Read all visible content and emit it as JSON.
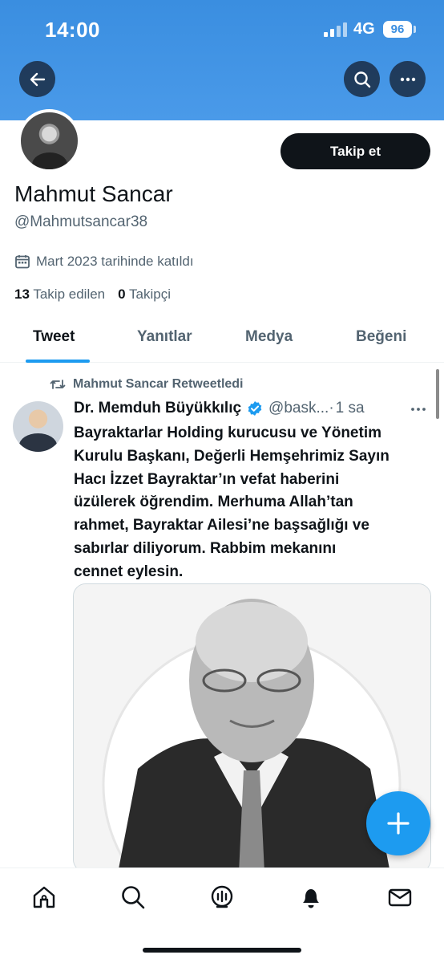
{
  "status_bar": {
    "time": "14:00",
    "network": "4G",
    "battery": "96"
  },
  "profile": {
    "display_name": "Mahmut Sancar",
    "handle": "@Mahmutsancar38",
    "joined": "Mart 2023 tarihinde katıldı",
    "following_count": "13",
    "following_label": "Takip edilen",
    "followers_count": "0",
    "followers_label": "Takipçi",
    "follow_button": "Takip et"
  },
  "tabs": [
    {
      "label": "Tweet",
      "active": true
    },
    {
      "label": "Yanıtlar",
      "active": false
    },
    {
      "label": "Medya",
      "active": false
    },
    {
      "label": "Beğeni",
      "active": false
    }
  ],
  "tweet": {
    "retweeted_by": "Mahmut Sancar Retweetledi",
    "author": "Dr. Memduh Büyükkılıç",
    "handle": "@bask...",
    "separator": "·",
    "time": "1 sa",
    "lines": [
      "Bayraktarlar Holding kurucusu ve Yönetim",
      "Kurulu Başkanı, Değerli Hemşehrimiz Sayın",
      "Hacı İzzet Bayraktar’ın vefat haberini",
      "üzülerek öğrendim. Merhuma Allah’tan",
      "rahmet, Bayraktar Ailesi’ne başsağlığı ve",
      "sabırlar diliyorum. Rabbim mekanını",
      "cennet eylesin."
    ]
  },
  "colors": {
    "accent": "#1d9bf0",
    "banner": "#3a8ee0",
    "text": "#0f1419",
    "muted": "#536471"
  },
  "icons": [
    "back-arrow-icon",
    "search-icon",
    "more-icon",
    "calendar-icon",
    "retweet-icon",
    "verified-badge-icon",
    "plus-icon",
    "home-icon",
    "explore-icon",
    "spaces-icon",
    "bell-icon",
    "mail-icon"
  ]
}
